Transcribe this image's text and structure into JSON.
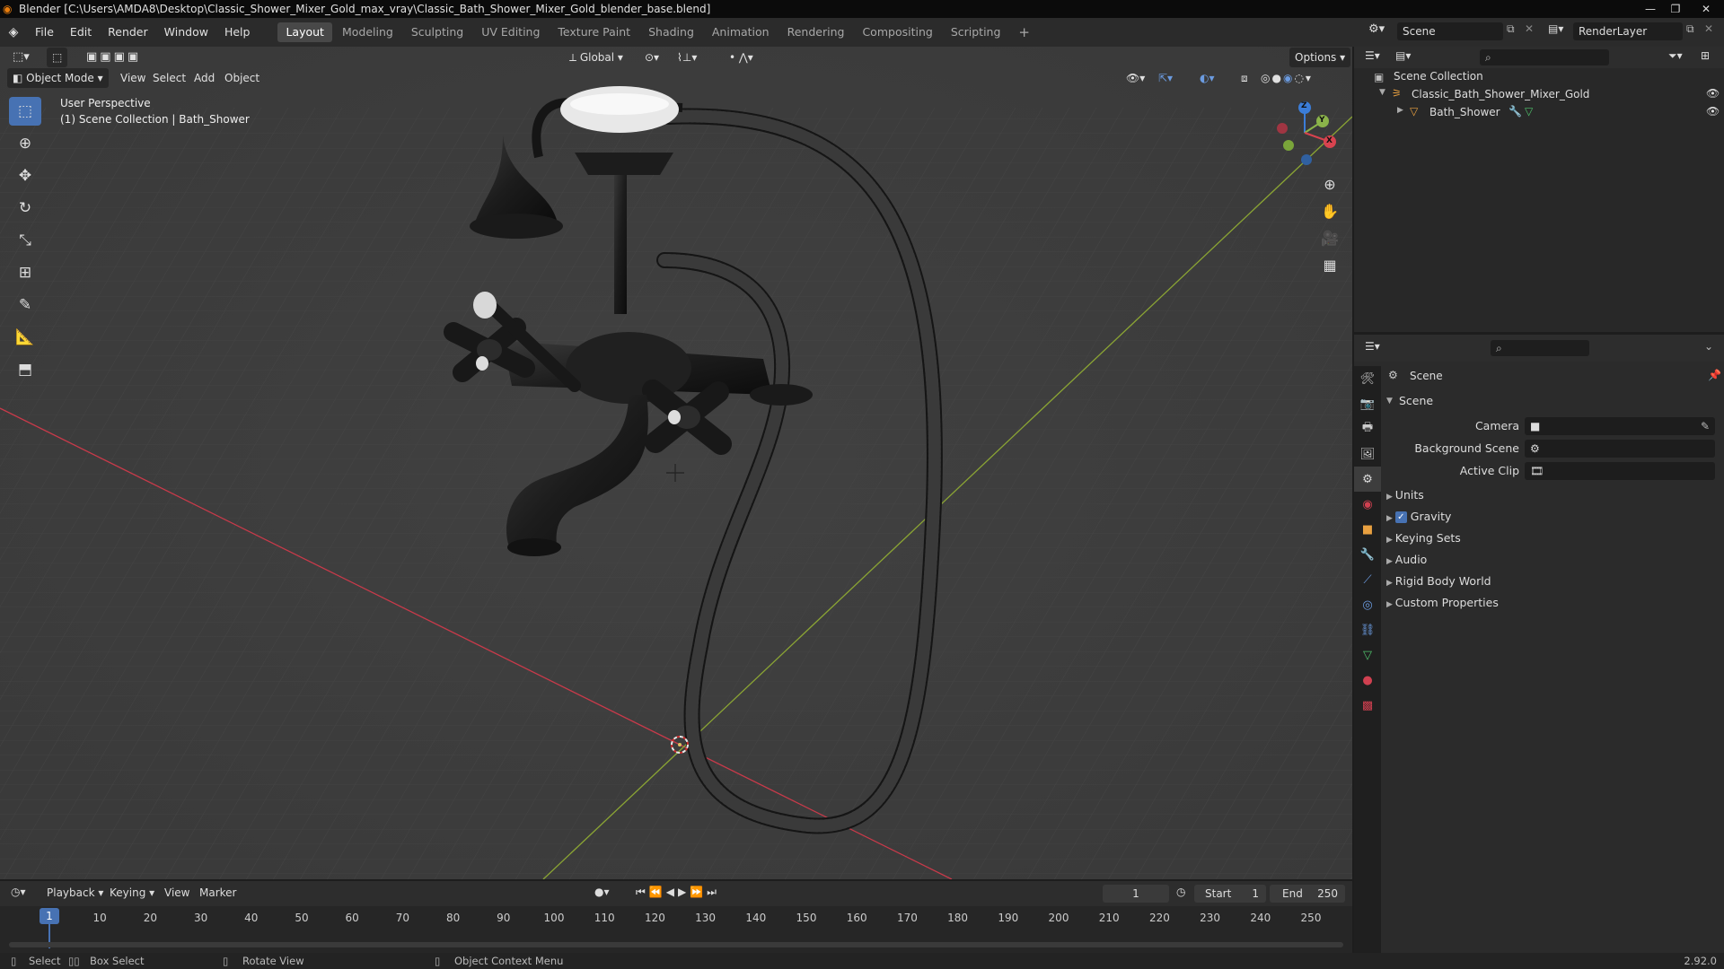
{
  "titlebar": {
    "title": "Blender [C:\\Users\\AMDA8\\Desktop\\Classic_Shower_Mixer_Gold_max_vray\\Classic_Bath_Shower_Mixer_Gold_blender_base.blend]",
    "minimize": "—",
    "maximize": "❐",
    "close": "✕"
  },
  "menu": [
    "File",
    "Edit",
    "Render",
    "Window",
    "Help"
  ],
  "workspaces": [
    "Layout",
    "Modeling",
    "Sculpting",
    "UV Editing",
    "Texture Paint",
    "Shading",
    "Animation",
    "Rendering",
    "Compositing",
    "Scripting"
  ],
  "workspace_add": "+",
  "scene_field": "Scene",
  "renderlayer_field": "RenderLayer",
  "viewport": {
    "transform_orientation": "Global",
    "options_label": "Options",
    "mode": "Object Mode",
    "header_menus": [
      "View",
      "Select",
      "Add",
      "Object"
    ],
    "perspective_label": "User Perspective",
    "collection_label": "(1) Scene Collection | Bath_Shower",
    "gizmo_axes": {
      "x": "X",
      "y": "Y",
      "z": "Z"
    }
  },
  "outliner": {
    "root": "Scene Collection",
    "collection": "Classic_Bath_Shower_Mixer_Gold",
    "object": "Bath_Shower"
  },
  "properties": {
    "context": "Scene",
    "panel_scene": "Scene",
    "camera_label": "Camera",
    "background_scene_label": "Background Scene",
    "active_clip_label": "Active Clip",
    "panels": [
      "Units",
      "Gravity",
      "Keying Sets",
      "Audio",
      "Rigid Body World",
      "Custom Properties"
    ],
    "gravity_checked": true
  },
  "timeline": {
    "menus": [
      "Playback",
      "Keying",
      "View",
      "Marker"
    ],
    "current_frame": "1",
    "start_label": "Start",
    "start_value": "1",
    "end_label": "End",
    "end_value": "250",
    "ruler": [
      "10",
      "20",
      "30",
      "40",
      "50",
      "60",
      "70",
      "80",
      "90",
      "100",
      "110",
      "120",
      "130",
      "140",
      "150",
      "160",
      "170",
      "180",
      "190",
      "200",
      "210",
      "220",
      "230",
      "240",
      "250"
    ],
    "playhead_label": "1"
  },
  "statusbar": {
    "select": "Select",
    "box_select": "Box Select",
    "rotate_view": "Rotate View",
    "context_menu": "Object Context Menu",
    "version": "2.92.0"
  }
}
